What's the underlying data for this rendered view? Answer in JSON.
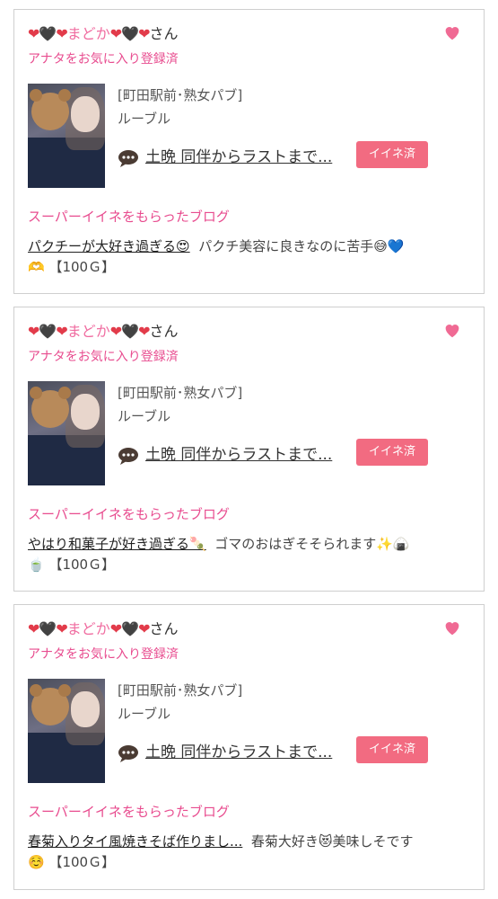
{
  "cards": [
    {
      "name_prefix": "❤🖤❤",
      "name": "まどか",
      "name_suffix": "❤🖤❤",
      "san": "さん",
      "fav_status": "アナタをお気に入り登録済",
      "shop": "[町田駅前･熟女パブ]",
      "cast_shop": "ルーブル",
      "message": "土晩 同伴からラストまで...",
      "iine_label": "イイネ済",
      "blog_heading": "スーパーイイネをもらったブログ",
      "blog_title": "パクチーが大好き過ぎる😍",
      "blog_text": "パクチ美容に良きなのに苦手😅💙🫶",
      "points": "【100Ｇ】"
    },
    {
      "name_prefix": "❤🖤❤",
      "name": "まどか",
      "name_suffix": "❤🖤❤",
      "san": "さん",
      "fav_status": "アナタをお気に入り登録済",
      "shop": "[町田駅前･熟女パブ]",
      "cast_shop": "ルーブル",
      "message": "土晩 同伴からラストまで...",
      "iine_label": "イイネ済",
      "blog_heading": "スーパーイイネをもらったブログ",
      "blog_title": "やはり和菓子が好き過ぎる🍡",
      "blog_text": "ゴマのおはぎそそられます✨🍙🍵",
      "points": "【100Ｇ】"
    },
    {
      "name_prefix": "❤🖤❤",
      "name": "まどか",
      "name_suffix": "❤🖤❤",
      "san": "さん",
      "fav_status": "アナタをお気に入り登録済",
      "shop": "[町田駅前･熟女パブ]",
      "cast_shop": "ルーブル",
      "message": "土晩 同伴からラストまで...",
      "iine_label": "イイネ済",
      "blog_heading": "スーパーイイネをもらったブログ",
      "blog_title": "春菊入りタイ風焼きそば作りまし...",
      "blog_text": "春菊大好き😻美味しそです☺️",
      "points": "【100Ｇ】"
    }
  ],
  "colors": {
    "accent_pink": "#e84c8f",
    "button_pink": "#f26b81",
    "heart_pink": "#f06a94",
    "border": "#cfcfcf"
  },
  "icons": {
    "favorite": "heart-icon",
    "message": "speech-bubble-icon"
  }
}
